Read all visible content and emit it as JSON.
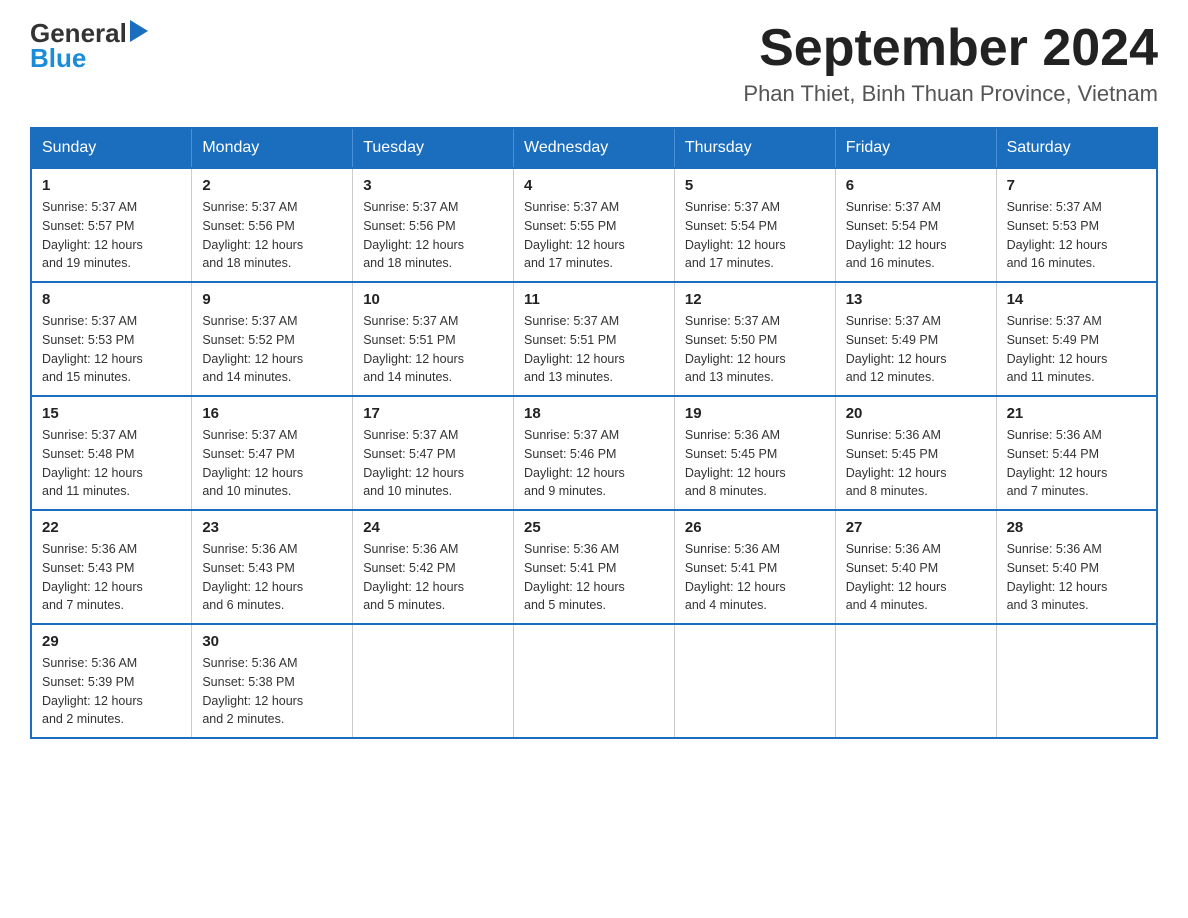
{
  "header": {
    "logo_line1": "General",
    "logo_arrow": "▶",
    "logo_line2": "Blue",
    "month_title": "September 2024",
    "location": "Phan Thiet, Binh Thuan Province, Vietnam"
  },
  "days_of_week": [
    "Sunday",
    "Monday",
    "Tuesday",
    "Wednesday",
    "Thursday",
    "Friday",
    "Saturday"
  ],
  "weeks": [
    [
      {
        "day": "1",
        "sunrise": "5:37 AM",
        "sunset": "5:57 PM",
        "daylight": "12 hours and 19 minutes."
      },
      {
        "day": "2",
        "sunrise": "5:37 AM",
        "sunset": "5:56 PM",
        "daylight": "12 hours and 18 minutes."
      },
      {
        "day": "3",
        "sunrise": "5:37 AM",
        "sunset": "5:56 PM",
        "daylight": "12 hours and 18 minutes."
      },
      {
        "day": "4",
        "sunrise": "5:37 AM",
        "sunset": "5:55 PM",
        "daylight": "12 hours and 17 minutes."
      },
      {
        "day": "5",
        "sunrise": "5:37 AM",
        "sunset": "5:54 PM",
        "daylight": "12 hours and 17 minutes."
      },
      {
        "day": "6",
        "sunrise": "5:37 AM",
        "sunset": "5:54 PM",
        "daylight": "12 hours and 16 minutes."
      },
      {
        "day": "7",
        "sunrise": "5:37 AM",
        "sunset": "5:53 PM",
        "daylight": "12 hours and 16 minutes."
      }
    ],
    [
      {
        "day": "8",
        "sunrise": "5:37 AM",
        "sunset": "5:53 PM",
        "daylight": "12 hours and 15 minutes."
      },
      {
        "day": "9",
        "sunrise": "5:37 AM",
        "sunset": "5:52 PM",
        "daylight": "12 hours and 14 minutes."
      },
      {
        "day": "10",
        "sunrise": "5:37 AM",
        "sunset": "5:51 PM",
        "daylight": "12 hours and 14 minutes."
      },
      {
        "day": "11",
        "sunrise": "5:37 AM",
        "sunset": "5:51 PM",
        "daylight": "12 hours and 13 minutes."
      },
      {
        "day": "12",
        "sunrise": "5:37 AM",
        "sunset": "5:50 PM",
        "daylight": "12 hours and 13 minutes."
      },
      {
        "day": "13",
        "sunrise": "5:37 AM",
        "sunset": "5:49 PM",
        "daylight": "12 hours and 12 minutes."
      },
      {
        "day": "14",
        "sunrise": "5:37 AM",
        "sunset": "5:49 PM",
        "daylight": "12 hours and 11 minutes."
      }
    ],
    [
      {
        "day": "15",
        "sunrise": "5:37 AM",
        "sunset": "5:48 PM",
        "daylight": "12 hours and 11 minutes."
      },
      {
        "day": "16",
        "sunrise": "5:37 AM",
        "sunset": "5:47 PM",
        "daylight": "12 hours and 10 minutes."
      },
      {
        "day": "17",
        "sunrise": "5:37 AM",
        "sunset": "5:47 PM",
        "daylight": "12 hours and 10 minutes."
      },
      {
        "day": "18",
        "sunrise": "5:37 AM",
        "sunset": "5:46 PM",
        "daylight": "12 hours and 9 minutes."
      },
      {
        "day": "19",
        "sunrise": "5:36 AM",
        "sunset": "5:45 PM",
        "daylight": "12 hours and 8 minutes."
      },
      {
        "day": "20",
        "sunrise": "5:36 AM",
        "sunset": "5:45 PM",
        "daylight": "12 hours and 8 minutes."
      },
      {
        "day": "21",
        "sunrise": "5:36 AM",
        "sunset": "5:44 PM",
        "daylight": "12 hours and 7 minutes."
      }
    ],
    [
      {
        "day": "22",
        "sunrise": "5:36 AM",
        "sunset": "5:43 PM",
        "daylight": "12 hours and 7 minutes."
      },
      {
        "day": "23",
        "sunrise": "5:36 AM",
        "sunset": "5:43 PM",
        "daylight": "12 hours and 6 minutes."
      },
      {
        "day": "24",
        "sunrise": "5:36 AM",
        "sunset": "5:42 PM",
        "daylight": "12 hours and 5 minutes."
      },
      {
        "day": "25",
        "sunrise": "5:36 AM",
        "sunset": "5:41 PM",
        "daylight": "12 hours and 5 minutes."
      },
      {
        "day": "26",
        "sunrise": "5:36 AM",
        "sunset": "5:41 PM",
        "daylight": "12 hours and 4 minutes."
      },
      {
        "day": "27",
        "sunrise": "5:36 AM",
        "sunset": "5:40 PM",
        "daylight": "12 hours and 4 minutes."
      },
      {
        "day": "28",
        "sunrise": "5:36 AM",
        "sunset": "5:40 PM",
        "daylight": "12 hours and 3 minutes."
      }
    ],
    [
      {
        "day": "29",
        "sunrise": "5:36 AM",
        "sunset": "5:39 PM",
        "daylight": "12 hours and 2 minutes."
      },
      {
        "day": "30",
        "sunrise": "5:36 AM",
        "sunset": "5:38 PM",
        "daylight": "12 hours and 2 minutes."
      },
      null,
      null,
      null,
      null,
      null
    ]
  ],
  "labels": {
    "sunrise": "Sunrise:",
    "sunset": "Sunset:",
    "daylight": "Daylight:"
  },
  "colors": {
    "header_bg": "#1a6ebd",
    "border": "#1a6ebd"
  }
}
